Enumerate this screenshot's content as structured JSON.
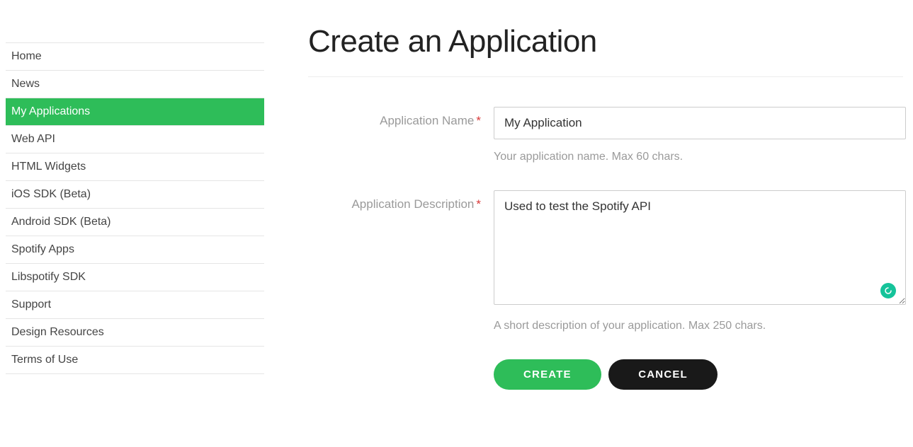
{
  "sidebar": {
    "items": [
      {
        "label": "Home",
        "active": false
      },
      {
        "label": "News",
        "active": false
      },
      {
        "label": "My Applications",
        "active": true
      },
      {
        "label": "Web API",
        "active": false
      },
      {
        "label": "HTML Widgets",
        "active": false
      },
      {
        "label": "iOS SDK (Beta)",
        "active": false
      },
      {
        "label": "Android SDK (Beta)",
        "active": false
      },
      {
        "label": "Spotify Apps",
        "active": false
      },
      {
        "label": "Libspotify SDK",
        "active": false
      },
      {
        "label": "Support",
        "active": false
      },
      {
        "label": "Design Resources",
        "active": false
      },
      {
        "label": "Terms of Use",
        "active": false
      }
    ]
  },
  "page": {
    "title": "Create an Application"
  },
  "form": {
    "name": {
      "label": "Application Name",
      "value": "My Application",
      "help": "Your application name. Max 60 chars."
    },
    "description": {
      "label": "Application Description",
      "value": "Used to test the Spotify API",
      "help": "A short description of your application. Max 250 chars."
    },
    "buttons": {
      "create": "CREATE",
      "cancel": "CANCEL"
    }
  }
}
